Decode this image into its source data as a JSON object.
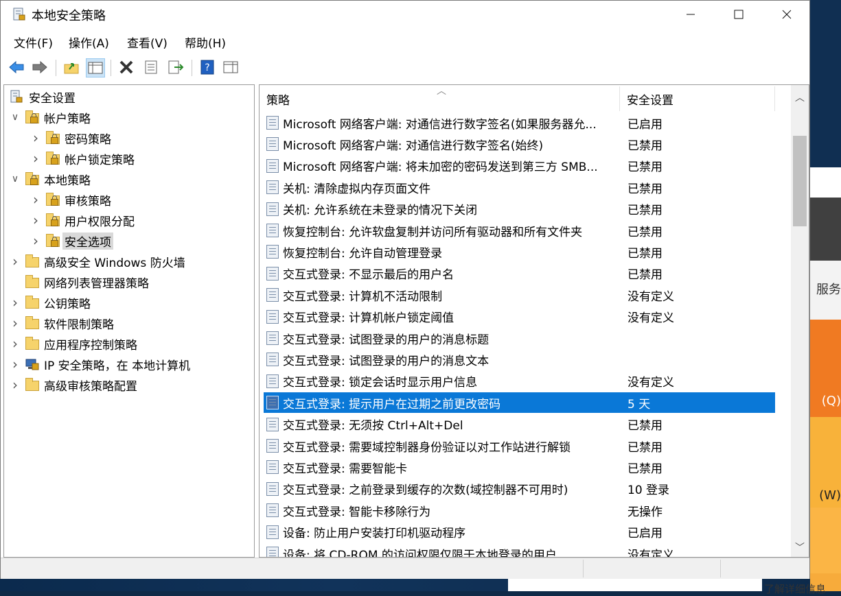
{
  "window": {
    "title": "本地安全策略"
  },
  "menu": {
    "file": "文件(F)",
    "action": "操作(A)",
    "view": "查看(V)",
    "help": "帮助(H)"
  },
  "tree": {
    "root": "安全设置",
    "items": [
      {
        "label": "帐户策略",
        "expanded": true
      },
      {
        "label": "密码策略"
      },
      {
        "label": "帐户锁定策略"
      },
      {
        "label": "本地策略",
        "expanded": true
      },
      {
        "label": "审核策略"
      },
      {
        "label": "用户权限分配"
      },
      {
        "label": "安全选项",
        "selected": true
      },
      {
        "label": "高级安全 Windows 防火墙"
      },
      {
        "label": "网络列表管理器策略"
      },
      {
        "label": "公钥策略"
      },
      {
        "label": "软件限制策略"
      },
      {
        "label": "应用程序控制策略"
      },
      {
        "label": "IP 安全策略，在 本地计算机"
      },
      {
        "label": "高级审核策略配置"
      }
    ]
  },
  "list": {
    "col_policy": "策略",
    "col_setting": "安全设置",
    "rows": [
      {
        "name": "Microsoft 网络客户端: 对通信进行数字签名(如果服务器允...",
        "value": "已启用"
      },
      {
        "name": "Microsoft 网络客户端: 对通信进行数字签名(始终)",
        "value": "已禁用"
      },
      {
        "name": "Microsoft 网络客户端: 将未加密的密码发送到第三方 SMB...",
        "value": "已禁用"
      },
      {
        "name": "关机: 清除虚拟内存页面文件",
        "value": "已禁用"
      },
      {
        "name": "关机: 允许系统在未登录的情况下关闭",
        "value": "已禁用"
      },
      {
        "name": "恢复控制台: 允许软盘复制并访问所有驱动器和所有文件夹",
        "value": "已禁用"
      },
      {
        "name": "恢复控制台: 允许自动管理登录",
        "value": "已禁用"
      },
      {
        "name": "交互式登录: 不显示最后的用户名",
        "value": "已禁用"
      },
      {
        "name": "交互式登录: 计算机不活动限制",
        "value": "没有定义"
      },
      {
        "name": "交互式登录: 计算机帐户锁定阈值",
        "value": "没有定义"
      },
      {
        "name": "交互式登录: 试图登录的用户的消息标题",
        "value": ""
      },
      {
        "name": "交互式登录: 试图登录的用户的消息文本",
        "value": ""
      },
      {
        "name": "交互式登录: 锁定会话时显示用户信息",
        "value": "没有定义"
      },
      {
        "name": "交互式登录: 提示用户在过期之前更改密码",
        "value": "5 天"
      },
      {
        "name": "交互式登录: 无须按 Ctrl+Alt+Del",
        "value": "已禁用"
      },
      {
        "name": "交互式登录: 需要域控制器身份验证以对工作站进行解锁",
        "value": "已禁用"
      },
      {
        "name": "交互式登录: 需要智能卡",
        "value": "已禁用"
      },
      {
        "name": "交互式登录: 之前登录到缓存的次数(域控制器不可用时)",
        "value": "10 登录"
      },
      {
        "name": "交互式登录: 智能卡移除行为",
        "value": "无操作"
      },
      {
        "name": "设备: 防止用户安装打印机驱动程序",
        "value": "已启用"
      },
      {
        "name": "设备: 将 CD-ROM 的访问权限仅限于本地登录的用户",
        "value": "没有定义"
      }
    ]
  },
  "background": {
    "text1": "服务",
    "text2": "(Q)",
    "text3": "(W)",
    "text4": "了解详细信息"
  },
  "colors": {
    "selection": "#0a78d7",
    "accent_orange": "#f07a22"
  }
}
